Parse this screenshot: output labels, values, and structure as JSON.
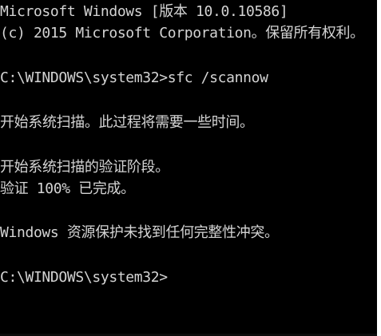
{
  "console": {
    "lines": [
      "Microsoft Windows [版本 10.0.10586]",
      "(c) 2015 Microsoft Corporation。保留所有权利。",
      "",
      "C:\\WINDOWS\\system32>sfc /scannow",
      "",
      "开始系统扫描。此过程将需要一些时间。",
      "",
      "开始系统扫描的验证阶段。",
      "验证 100% 已完成。",
      "",
      "Windows 资源保护未找到任何完整性冲突。",
      "",
      "C:\\WINDOWS\\system32>"
    ]
  },
  "colors": {
    "background": "#000000",
    "text": "#d4d4d4"
  }
}
